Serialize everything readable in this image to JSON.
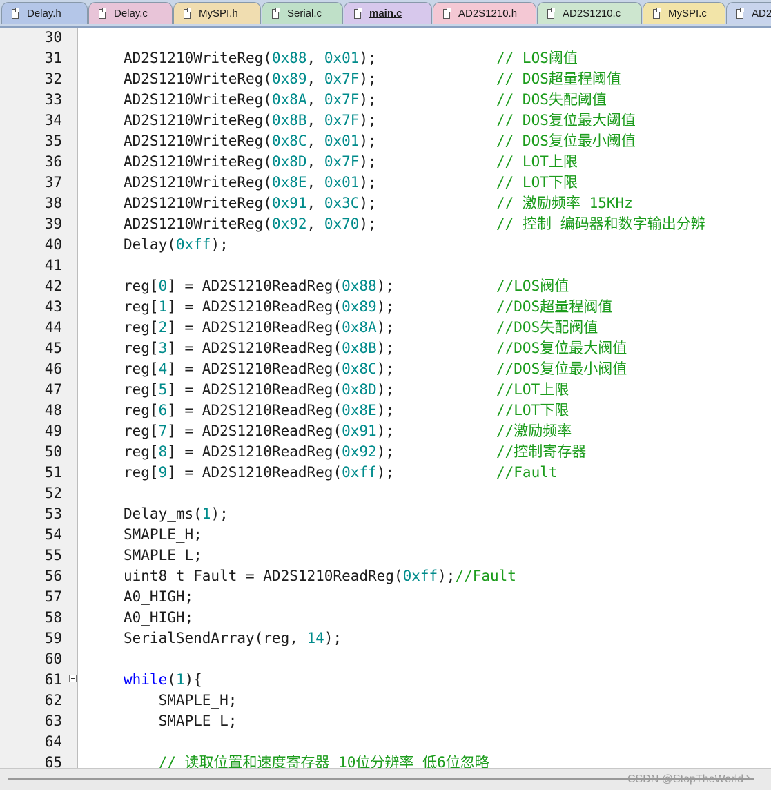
{
  "tabs": [
    {
      "label": "Delay.h",
      "color": "#b4c6e8"
    },
    {
      "label": "Delay.c",
      "color": "#e8c4d8"
    },
    {
      "label": "MySPI.h",
      "color": "#f0ddb0"
    },
    {
      "label": "Serial.c",
      "color": "#bfe0c8"
    },
    {
      "label": "main.c",
      "color": "#d7c8ec",
      "active": true
    },
    {
      "label": "AD2S1210.h",
      "color": "#f4c8d4"
    },
    {
      "label": "AD2S1210.c",
      "color": "#cde6cf"
    },
    {
      "label": "MySPI.c",
      "color": "#f2e4a8"
    },
    {
      "label": "AD2",
      "color": "#c8d4ec"
    }
  ],
  "lines": [
    {
      "n": "30",
      "code": "",
      "comment": ""
    },
    {
      "n": "31",
      "code": "AD2S1210WriteReg(0x88, 0x01);",
      "comment": "// LOS阈值"
    },
    {
      "n": "32",
      "code": "AD2S1210WriteReg(0x89, 0x7F);",
      "comment": "// DOS超量程阈值"
    },
    {
      "n": "33",
      "code": "AD2S1210WriteReg(0x8A, 0x7F);",
      "comment": "// DOS失配阈值"
    },
    {
      "n": "34",
      "code": "AD2S1210WriteReg(0x8B, 0x7F);",
      "comment": "// DOS复位最大阈值"
    },
    {
      "n": "35",
      "code": "AD2S1210WriteReg(0x8C, 0x01);",
      "comment": "// DOS复位最小阈值"
    },
    {
      "n": "36",
      "code": "AD2S1210WriteReg(0x8D, 0x7F);",
      "comment": "// LOT上限"
    },
    {
      "n": "37",
      "code": "AD2S1210WriteReg(0x8E, 0x01);",
      "comment": "// LOT下限"
    },
    {
      "n": "38",
      "code": "AD2S1210WriteReg(0x91, 0x3C);",
      "comment": "// 激励频率 15KHz"
    },
    {
      "n": "39",
      "code": "AD2S1210WriteReg(0x92, 0x70);",
      "comment": "// 控制 编码器和数字输出分辨"
    },
    {
      "n": "40",
      "code": "Delay(0xff);",
      "comment": ""
    },
    {
      "n": "41",
      "code": "",
      "comment": ""
    },
    {
      "n": "42",
      "code": "reg[0] = AD2S1210ReadReg(0x88);",
      "comment": "//LOS阀值"
    },
    {
      "n": "43",
      "code": "reg[1] = AD2S1210ReadReg(0x89);",
      "comment": "//DOS超量程阀值"
    },
    {
      "n": "44",
      "code": "reg[2] = AD2S1210ReadReg(0x8A);",
      "comment": "//DOS失配阀值"
    },
    {
      "n": "45",
      "code": "reg[3] = AD2S1210ReadReg(0x8B);",
      "comment": "//DOS复位最大阀值"
    },
    {
      "n": "46",
      "code": "reg[4] = AD2S1210ReadReg(0x8C);",
      "comment": "//DOS复位最小阀值"
    },
    {
      "n": "47",
      "code": "reg[5] = AD2S1210ReadReg(0x8D);",
      "comment": "//LOT上限"
    },
    {
      "n": "48",
      "code": "reg[6] = AD2S1210ReadReg(0x8E);",
      "comment": "//LOT下限"
    },
    {
      "n": "49",
      "code": "reg[7] = AD2S1210ReadReg(0x91);",
      "comment": "//激励频率"
    },
    {
      "n": "50",
      "code": "reg[8] = AD2S1210ReadReg(0x92);",
      "comment": "//控制寄存器"
    },
    {
      "n": "51",
      "code": "reg[9] = AD2S1210ReadReg(0xff);",
      "comment": "//Fault"
    },
    {
      "n": "52",
      "code": "",
      "comment": ""
    },
    {
      "n": "53",
      "code": "Delay_ms(1);",
      "comment": ""
    },
    {
      "n": "54",
      "code": "SMAPLE_H;",
      "comment": ""
    },
    {
      "n": "55",
      "code": "SMAPLE_L;",
      "comment": ""
    },
    {
      "n": "56",
      "code": "uint8_t Fault = AD2S1210ReadReg(0xff);//Fault",
      "comment": ""
    },
    {
      "n": "57",
      "code": "A0_HIGH;",
      "comment": ""
    },
    {
      "n": "58",
      "code": "A0_HIGH;",
      "comment": ""
    },
    {
      "n": "59",
      "code": "SerialSendArray(reg, 14);",
      "comment": ""
    },
    {
      "n": "60",
      "code": "",
      "comment": ""
    },
    {
      "n": "61",
      "code": "while(1){",
      "comment": "",
      "fold": true
    },
    {
      "n": "62",
      "code": "    SMAPLE_H;",
      "comment": ""
    },
    {
      "n": "63",
      "code": "    SMAPLE_L;",
      "comment": ""
    },
    {
      "n": "64",
      "code": "",
      "comment": ""
    },
    {
      "n": "65",
      "code": "    // 读取位置和速度寄存器 10位分辨率 低6位忽略",
      "comment": ""
    }
  ],
  "watermark": "CSDN @StopTheWorld丶",
  "colors": {
    "keyword": "#0000ff",
    "number": "#008b8b",
    "comment": "#1c9c1c"
  }
}
